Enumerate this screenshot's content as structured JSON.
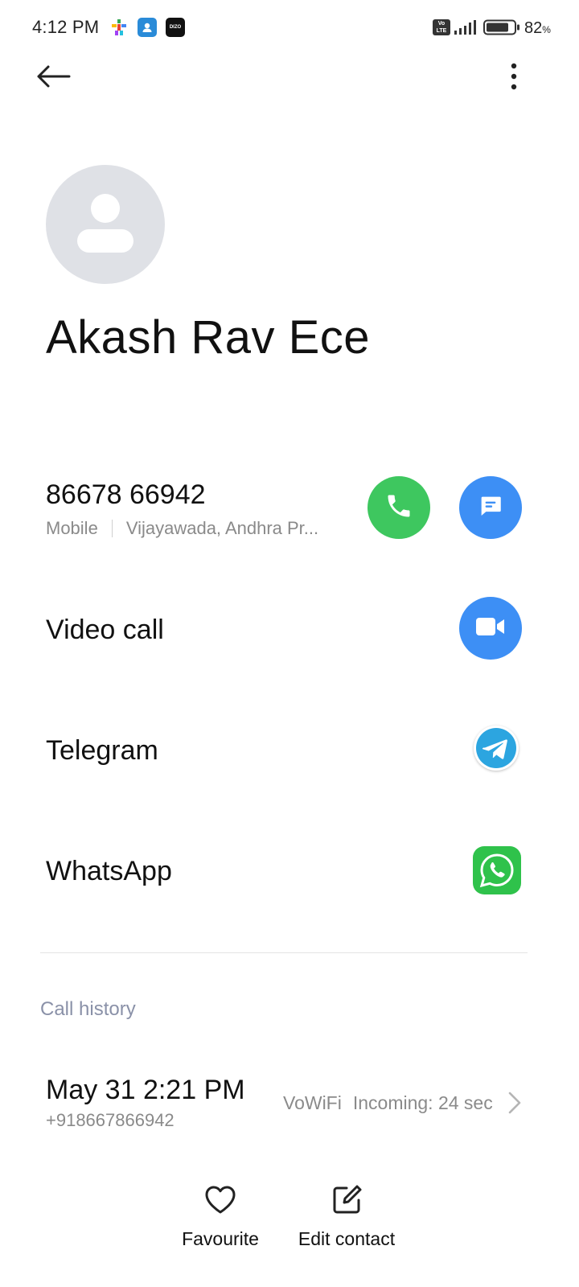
{
  "status_bar": {
    "time": "4:12 PM",
    "notification_icons": [
      "play-games-icon",
      "contacts-app-icon",
      "dizo-app-icon"
    ],
    "dizo_label": "DIZO",
    "volte_label": "Vo\nLTE",
    "battery_percent": "82",
    "battery_suffix": "%",
    "battery_level": 0.82
  },
  "toolbar": {
    "back_icon": "arrow-left-icon",
    "more_icon": "more-vertical-icon"
  },
  "contact": {
    "name": "Akash Rav Ece",
    "avatar_icon": "person-placeholder-icon"
  },
  "phone": {
    "number": "86678 66942",
    "type": "Mobile",
    "location": "Vijayawada, Andhra Pr...",
    "call_icon": "phone-icon",
    "message_icon": "message-icon"
  },
  "options": [
    {
      "label": "Video call",
      "icon": "video-camera-icon"
    },
    {
      "label": "Telegram",
      "icon": "telegram-icon"
    },
    {
      "label": "WhatsApp",
      "icon": "whatsapp-icon"
    }
  ],
  "call_history": {
    "title": "Call history",
    "items": [
      {
        "datetime": "May 31 2:21 PM",
        "number": "+918667866942",
        "network": "VoWiFi",
        "detail": "Incoming: 24 sec"
      }
    ]
  },
  "bottom_actions": {
    "favourite_label": "Favourite",
    "edit_label": "Edit contact"
  },
  "colors": {
    "call_green": "#3ec75f",
    "action_blue": "#3d8ff5",
    "whatsapp_green": "#2fc24b",
    "telegram_blue": "#2ca5e0",
    "section_title": "#8a91a8"
  }
}
